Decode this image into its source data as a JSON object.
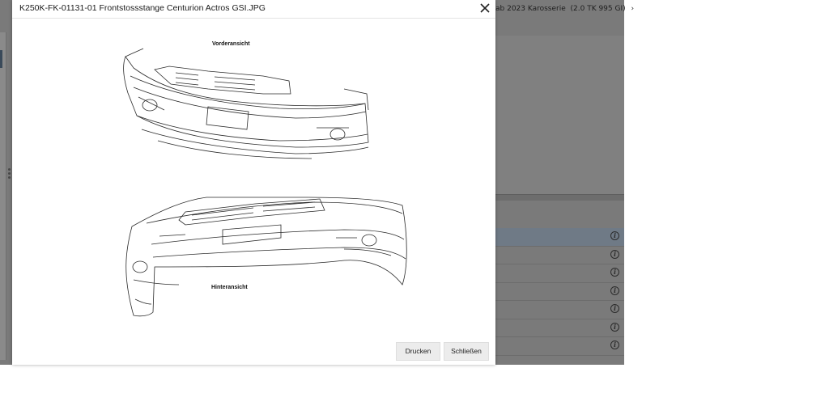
{
  "modal": {
    "title": "K250K-FK-01131-01 Frontstossstange Centurion Actros GSI.JPG",
    "close_icon": "close-icon",
    "buttons": {
      "print_label": "Drucken",
      "close_label": "Schließen"
    }
  },
  "drawing": {
    "front_view_label": "Vorderansicht",
    "rear_view_label": "Hinteransicht"
  },
  "background": {
    "breadcrumb": {
      "part1": "ab 2023 Karosserie",
      "part2": "(2.0 TK 995 GI)"
    },
    "row_count": 7,
    "row_icon": "info-icon"
  },
  "colors": {
    "overlay": "#7a7a7a",
    "modal_bg": "#ffffff",
    "button_bg": "#ececec",
    "selected_row": "#6f7a86"
  }
}
